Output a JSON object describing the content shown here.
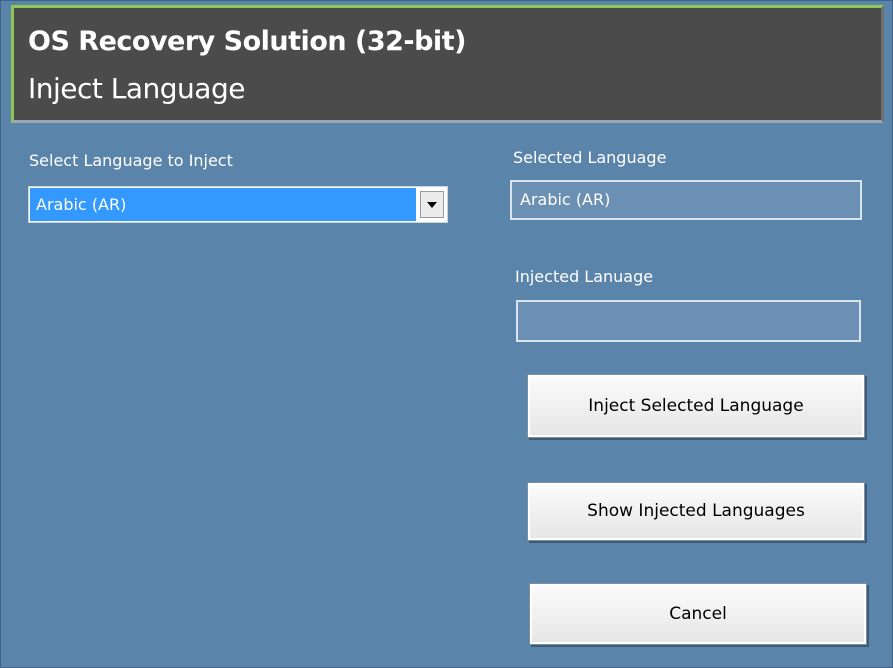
{
  "header": {
    "title": "OS Recovery Solution (32-bit)",
    "subtitle": "Inject Language"
  },
  "language_select": {
    "label": "Select Language to Inject",
    "value": "Arabic (AR)"
  },
  "selected_language": {
    "label": "Selected Language",
    "value": "Arabic (AR)"
  },
  "injected_language": {
    "label": "Injected Lanuage",
    "value": ""
  },
  "buttons": {
    "inject": "Inject Selected Language",
    "show": "Show Injected Languages",
    "cancel": "Cancel"
  },
  "icons": {
    "dropdown": "chevron-down-icon"
  }
}
